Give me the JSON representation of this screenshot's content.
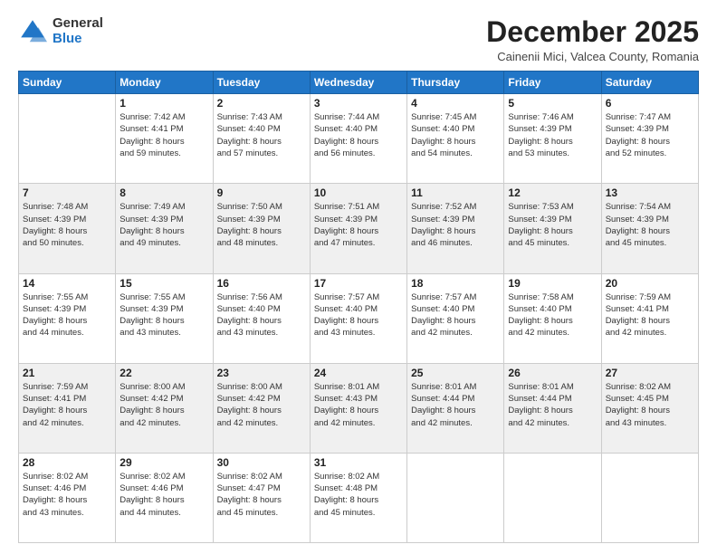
{
  "logo": {
    "general": "General",
    "blue": "Blue"
  },
  "header": {
    "month": "December 2025",
    "location": "Cainenii Mici, Valcea County, Romania"
  },
  "weekdays": [
    "Sunday",
    "Monday",
    "Tuesday",
    "Wednesday",
    "Thursday",
    "Friday",
    "Saturday"
  ],
  "weeks": [
    [
      {
        "day": "",
        "info": ""
      },
      {
        "day": "1",
        "info": "Sunrise: 7:42 AM\nSunset: 4:41 PM\nDaylight: 8 hours\nand 59 minutes."
      },
      {
        "day": "2",
        "info": "Sunrise: 7:43 AM\nSunset: 4:40 PM\nDaylight: 8 hours\nand 57 minutes."
      },
      {
        "day": "3",
        "info": "Sunrise: 7:44 AM\nSunset: 4:40 PM\nDaylight: 8 hours\nand 56 minutes."
      },
      {
        "day": "4",
        "info": "Sunrise: 7:45 AM\nSunset: 4:40 PM\nDaylight: 8 hours\nand 54 minutes."
      },
      {
        "day": "5",
        "info": "Sunrise: 7:46 AM\nSunset: 4:39 PM\nDaylight: 8 hours\nand 53 minutes."
      },
      {
        "day": "6",
        "info": "Sunrise: 7:47 AM\nSunset: 4:39 PM\nDaylight: 8 hours\nand 52 minutes."
      }
    ],
    [
      {
        "day": "7",
        "info": "Sunrise: 7:48 AM\nSunset: 4:39 PM\nDaylight: 8 hours\nand 50 minutes."
      },
      {
        "day": "8",
        "info": "Sunrise: 7:49 AM\nSunset: 4:39 PM\nDaylight: 8 hours\nand 49 minutes."
      },
      {
        "day": "9",
        "info": "Sunrise: 7:50 AM\nSunset: 4:39 PM\nDaylight: 8 hours\nand 48 minutes."
      },
      {
        "day": "10",
        "info": "Sunrise: 7:51 AM\nSunset: 4:39 PM\nDaylight: 8 hours\nand 47 minutes."
      },
      {
        "day": "11",
        "info": "Sunrise: 7:52 AM\nSunset: 4:39 PM\nDaylight: 8 hours\nand 46 minutes."
      },
      {
        "day": "12",
        "info": "Sunrise: 7:53 AM\nSunset: 4:39 PM\nDaylight: 8 hours\nand 45 minutes."
      },
      {
        "day": "13",
        "info": "Sunrise: 7:54 AM\nSunset: 4:39 PM\nDaylight: 8 hours\nand 45 minutes."
      }
    ],
    [
      {
        "day": "14",
        "info": "Sunrise: 7:55 AM\nSunset: 4:39 PM\nDaylight: 8 hours\nand 44 minutes."
      },
      {
        "day": "15",
        "info": "Sunrise: 7:55 AM\nSunset: 4:39 PM\nDaylight: 8 hours\nand 43 minutes."
      },
      {
        "day": "16",
        "info": "Sunrise: 7:56 AM\nSunset: 4:40 PM\nDaylight: 8 hours\nand 43 minutes."
      },
      {
        "day": "17",
        "info": "Sunrise: 7:57 AM\nSunset: 4:40 PM\nDaylight: 8 hours\nand 43 minutes."
      },
      {
        "day": "18",
        "info": "Sunrise: 7:57 AM\nSunset: 4:40 PM\nDaylight: 8 hours\nand 42 minutes."
      },
      {
        "day": "19",
        "info": "Sunrise: 7:58 AM\nSunset: 4:40 PM\nDaylight: 8 hours\nand 42 minutes."
      },
      {
        "day": "20",
        "info": "Sunrise: 7:59 AM\nSunset: 4:41 PM\nDaylight: 8 hours\nand 42 minutes."
      }
    ],
    [
      {
        "day": "21",
        "info": "Sunrise: 7:59 AM\nSunset: 4:41 PM\nDaylight: 8 hours\nand 42 minutes."
      },
      {
        "day": "22",
        "info": "Sunrise: 8:00 AM\nSunset: 4:42 PM\nDaylight: 8 hours\nand 42 minutes."
      },
      {
        "day": "23",
        "info": "Sunrise: 8:00 AM\nSunset: 4:42 PM\nDaylight: 8 hours\nand 42 minutes."
      },
      {
        "day": "24",
        "info": "Sunrise: 8:01 AM\nSunset: 4:43 PM\nDaylight: 8 hours\nand 42 minutes."
      },
      {
        "day": "25",
        "info": "Sunrise: 8:01 AM\nSunset: 4:44 PM\nDaylight: 8 hours\nand 42 minutes."
      },
      {
        "day": "26",
        "info": "Sunrise: 8:01 AM\nSunset: 4:44 PM\nDaylight: 8 hours\nand 42 minutes."
      },
      {
        "day": "27",
        "info": "Sunrise: 8:02 AM\nSunset: 4:45 PM\nDaylight: 8 hours\nand 43 minutes."
      }
    ],
    [
      {
        "day": "28",
        "info": "Sunrise: 8:02 AM\nSunset: 4:46 PM\nDaylight: 8 hours\nand 43 minutes."
      },
      {
        "day": "29",
        "info": "Sunrise: 8:02 AM\nSunset: 4:46 PM\nDaylight: 8 hours\nand 44 minutes."
      },
      {
        "day": "30",
        "info": "Sunrise: 8:02 AM\nSunset: 4:47 PM\nDaylight: 8 hours\nand 45 minutes."
      },
      {
        "day": "31",
        "info": "Sunrise: 8:02 AM\nSunset: 4:48 PM\nDaylight: 8 hours\nand 45 minutes."
      },
      {
        "day": "",
        "info": ""
      },
      {
        "day": "",
        "info": ""
      },
      {
        "day": "",
        "info": ""
      }
    ]
  ]
}
